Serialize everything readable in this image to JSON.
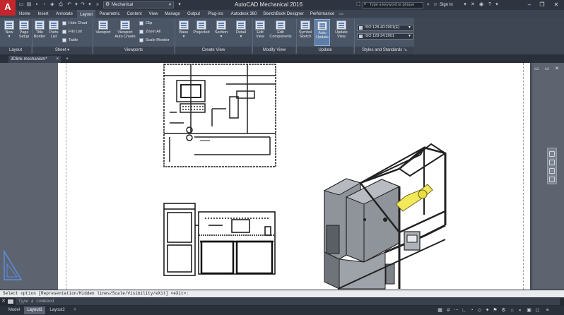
{
  "window": {
    "title": "AutoCAD Mechanical 2016",
    "workspace": "Mechanical",
    "search_placeholder": "Type a keyword or phrase",
    "sign_in": "Sign In",
    "app_logo": "A"
  },
  "tabs": [
    {
      "label": "Home"
    },
    {
      "label": "Insert"
    },
    {
      "label": "Annotate"
    },
    {
      "label": "Layout"
    },
    {
      "label": "Parametric"
    },
    {
      "label": "Content"
    },
    {
      "label": "View"
    },
    {
      "label": "Manage"
    },
    {
      "label": "Output"
    },
    {
      "label": "Plug-ins"
    },
    {
      "label": "Autodesk 360"
    },
    {
      "label": "SketchBook Designer"
    },
    {
      "label": "Performance"
    }
  ],
  "ribbon": {
    "layout_panel": {
      "title": "Layout",
      "new": "New",
      "page_setup": [
        "Page",
        "Setup"
      ]
    },
    "sheet_panel": {
      "title": "Sheet",
      "title_border": [
        "Title",
        "Border"
      ],
      "parts_list": [
        "Parts",
        "List"
      ],
      "hole_chart": "Hole Chart",
      "fits_list": "Fits List",
      "table": "Table"
    },
    "viewports_panel": {
      "title": "Viewports",
      "viewport": "Viewport",
      "viewport_auto_create": [
        "Viewport",
        "Auto Create"
      ],
      "clip": "Clip",
      "zoom_all": "Zoom All",
      "scale_monitor": "Scale Monitor"
    },
    "create_view_panel": {
      "title": "Create View",
      "base": "Base",
      "projected": "Projected",
      "section": "Section",
      "detail": "Detail"
    },
    "modify_view_panel": {
      "title": "Modify View",
      "edit_view": [
        "Edit",
        "View"
      ],
      "edit_components": [
        "Edit",
        "Components"
      ]
    },
    "update_panel": {
      "title": "Update",
      "symbol_sketch": [
        "Symbol",
        "Sketch"
      ],
      "auto_update": [
        "Auto",
        "Update"
      ],
      "update_view": [
        "Update",
        "View"
      ]
    },
    "styles_panel": {
      "title": "Styles and Standards",
      "standard_1": "ISO 128-40:2001(E)",
      "standard_2": "ISO 128-34:2001"
    }
  },
  "document": {
    "tab_label": "3Dlink-mechanism*"
  },
  "command_line": {
    "history": "Select option [Representation/Hidden lines/Scale/Visibility/eXit] <eXit>:",
    "input_placeholder": "Type a command"
  },
  "status_bar": {
    "layout_tabs": [
      {
        "label": "Model"
      },
      {
        "label": "Layout1"
      },
      {
        "label": "Layout2"
      }
    ]
  }
}
